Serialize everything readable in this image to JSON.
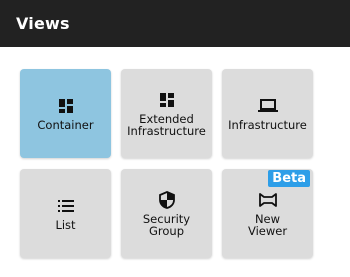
{
  "header": {
    "title": "Views"
  },
  "tiles": [
    {
      "label": "Container",
      "icon": "dashboard-icon",
      "selected": true
    },
    {
      "label": "Extended\nInfrastructure",
      "icon": "dashboard-icon",
      "selected": false
    },
    {
      "label": "Infrastructure",
      "icon": "laptop-icon",
      "selected": false
    },
    {
      "label": "List",
      "icon": "list-icon",
      "selected": false
    },
    {
      "label": "Security\nGroup",
      "icon": "shield-icon",
      "selected": false
    },
    {
      "label": "New\nViewer",
      "icon": "viewer-icon",
      "selected": false,
      "badge": "Beta"
    }
  ],
  "colors": {
    "header_bg": "#222222",
    "tile_bg": "#dcdcdc",
    "tile_selected_bg": "#8ec5e0",
    "badge_bg": "#2d9ee8"
  }
}
